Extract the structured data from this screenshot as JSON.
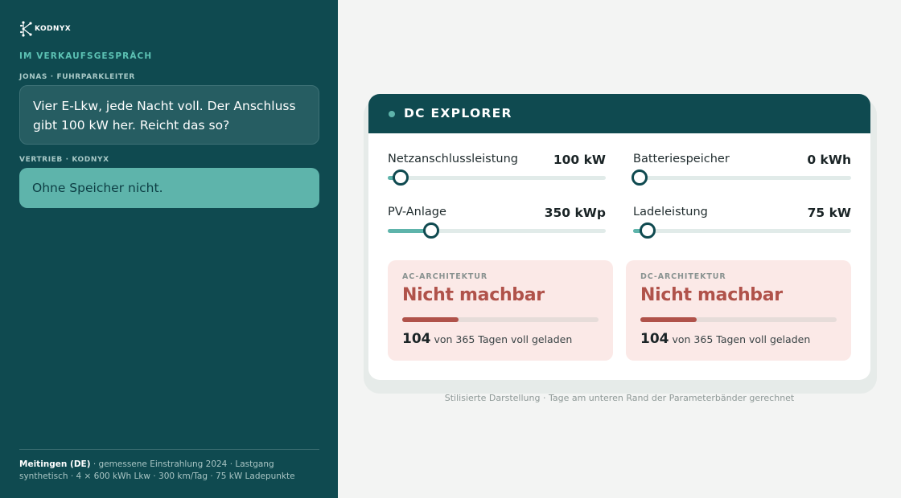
{
  "sidebar": {
    "logo_text": "KODNYX",
    "section_label": "IM VERKAUFSGESPRÄCH",
    "messages": [
      {
        "speaker": "JONAS · FUHRPARKLEITER",
        "text": "Vier E-Lkw, jede Nacht voll. Der Anschluss gibt 100 kW her. Reicht das so?"
      },
      {
        "speaker": "VERTRIEB · KODNYX",
        "text": "Ohne Speicher nicht."
      }
    ],
    "footnote_location": "Meitingen (DE)",
    "footnote_text": " · gemessene Einstrahlung 2024 · Lastgang synthetisch · 4 × 600 kWh Lkw · 300 km/Tag · 75 kW Ladepunkte"
  },
  "explorer": {
    "title": "DC EXPLORER",
    "sliders": [
      {
        "label": "Netzanschlussleistung",
        "value": "100 kW",
        "level": 0.03
      },
      {
        "label": "Batteriespeicher",
        "value": "0 kWh",
        "level": 0.0
      },
      {
        "label": "PV-Anlage",
        "value": "350 kWp",
        "level": 0.18
      },
      {
        "label": "Ladeleistung",
        "value": "75 kW",
        "level": 0.04
      }
    ],
    "results": [
      {
        "kicker": "AC-ARCHITEKTUR",
        "status": "Nicht machbar",
        "days": "104",
        "days_text": " von 365 Tagen voll geladen",
        "fraction": 0.285
      },
      {
        "kicker": "DC-ARCHITEKTUR",
        "status": "Nicht machbar",
        "days": "104",
        "days_text": " von 365 Tagen voll geladen",
        "fraction": 0.285
      }
    ],
    "caption": "Stilisierte Darstellung · Tage am unteren Rand der Parameterbänder gerechnet"
  },
  "colors": {
    "brand_dark": "#0f4a50",
    "accent_teal": "#5eb4ab",
    "status_red": "#b0524a",
    "result_bg": "#fbe9e7"
  },
  "icons": {
    "logo": "kodnyx-network-logo-icon",
    "header_dot": "status-dot-icon"
  }
}
